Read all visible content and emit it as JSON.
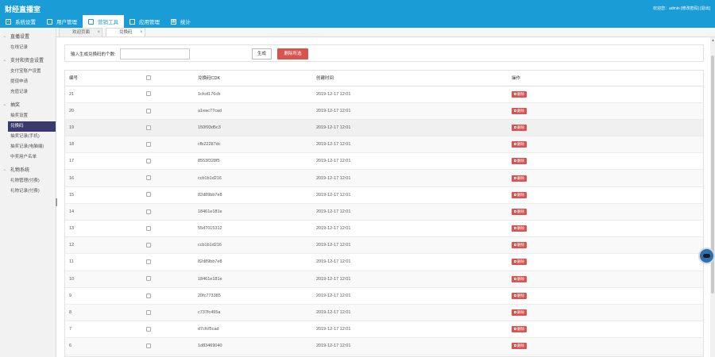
{
  "header": {
    "app_title": "财经直播室",
    "user_info": "欢迎您：admin [修改密码] [退出]",
    "nav": [
      {
        "label": "系统设置",
        "icon": "home-icon"
      },
      {
        "label": "用户管理",
        "icon": "user-icon"
      },
      {
        "label": "营销工具",
        "icon": "tool-icon"
      },
      {
        "label": "应用管理",
        "icon": "app-icon"
      },
      {
        "label": "统计",
        "icon": "chart-icon"
      }
    ]
  },
  "sidebar": {
    "groups": [
      {
        "label": "直播设置",
        "items": [
          "在线记录"
        ]
      },
      {
        "label": "支付和资金设置",
        "items": [
          "支付宝账户设置",
          "提现申请",
          "充值记录"
        ]
      },
      {
        "label": "抽奖",
        "items": [
          "抽奖设置",
          "兑换码",
          "抽奖记录(手机)",
          "抽奖记录(电脑端)",
          "中奖用户名单"
        ]
      },
      {
        "label": "礼物系统",
        "items": [
          "礼物管理(付费)",
          "礼物记录(付费)"
        ]
      }
    ]
  },
  "tabs": [
    {
      "label": "欢迎页面"
    },
    {
      "label": "兑换码"
    }
  ],
  "search": {
    "label": "输入生成兑换码的个数:",
    "input_value": "",
    "generate_label": "生成",
    "batch_delete_label": "删除所选"
  },
  "table": {
    "headers": [
      "编号",
      "",
      "兑换码CDK",
      "创建时间",
      "操作"
    ],
    "delete_label": "删除",
    "rows": [
      {
        "id": "21",
        "code": "1cfcd176cb",
        "time": "2019-12-17 12:01"
      },
      {
        "id": "20",
        "code": "a1eac77cad",
        "time": "2019-12-17 12:01"
      },
      {
        "id": "19",
        "code": "150f93d5c3",
        "time": "2019-12-17 12:01"
      },
      {
        "id": "18",
        "code": "cfb22287dc",
        "time": "2019-12-17 12:01"
      },
      {
        "id": "17",
        "code": "8553f328f5",
        "time": "2019-12-17 12:01"
      },
      {
        "id": "16",
        "code": "ccb1b1d216",
        "time": "2019-12-17 12:01"
      },
      {
        "id": "15",
        "code": "82d89bb7e8",
        "time": "2019-12-17 12:01"
      },
      {
        "id": "14",
        "code": "18461e181e",
        "time": "2019-12-17 12:01"
      },
      {
        "id": "13",
        "code": "55d7015312",
        "time": "2019-12-17 12:01"
      },
      {
        "id": "12",
        "code": "ccb1b1d216",
        "time": "2019-12-17 12:01"
      },
      {
        "id": "11",
        "code": "82d89bb7e8",
        "time": "2019-12-17 12:01"
      },
      {
        "id": "10",
        "code": "18461e181e",
        "time": "2019-12-17 12:01"
      },
      {
        "id": "9",
        "code": "20fc773385",
        "time": "2019-12-17 12:01"
      },
      {
        "id": "8",
        "code": "c737fc495a",
        "time": "2019-12-17 12:01"
      },
      {
        "id": "7",
        "code": "d7cfcf5cad",
        "time": "2019-12-17 12:01"
      },
      {
        "id": "6",
        "code": "1d83469040",
        "time": "2019-12-17 12:01"
      }
    ]
  },
  "colors": {
    "header": "#1a9cd6",
    "danger": "#d9534f",
    "active_sidebar": "#3a3a6e"
  }
}
